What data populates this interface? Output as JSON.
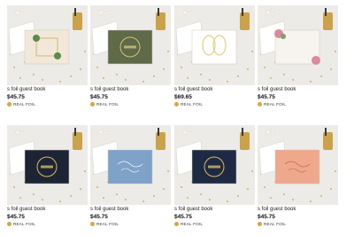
{
  "products": [
    {
      "title": "s foil guest book",
      "price": "$45.75",
      "badge": "REAL FOIL",
      "card_color": "#f1e8da",
      "accent": "#5c8a4a",
      "design": "greenery-frame"
    },
    {
      "title": "s foil guest book",
      "price": "$45.75",
      "badge": "REAL FOIL",
      "card_color": "#5e6a48",
      "accent": "#d8c07a",
      "design": "gold-wreath"
    },
    {
      "title": "s foil guest book",
      "price": "$69.65",
      "badge": "REAL FOIL",
      "card_color": "#ffffff",
      "accent": "#e2cf82",
      "design": "gold-angel-wings"
    },
    {
      "title": "s foil guest book",
      "price": "$45.75",
      "badge": "REAL FOIL",
      "card_color": "#f7f3ee",
      "accent": "#d88aa0",
      "design": "floral-corners"
    },
    {
      "title": "s foil guest book",
      "price": "$45.75",
      "badge": "REAL FOIL",
      "card_color": "#1d2436",
      "accent": "#d8b860",
      "design": "navy-gold-wreath"
    },
    {
      "title": "s foil guest book",
      "price": "$45.75",
      "badge": "REAL FOIL",
      "card_color": "#7ea2c8",
      "accent": "#ffffff",
      "design": "blue-script"
    },
    {
      "title": "s foil guest book",
      "price": "$45.75",
      "badge": "REAL FOIL",
      "card_color": "#1e2a44",
      "accent": "#d8b860",
      "design": "navy-circle-wreath"
    },
    {
      "title": "s foil guest book",
      "price": "$45.75",
      "badge": "REAL FOIL",
      "card_color": "#efa88c",
      "accent": "#b86c55",
      "design": "peach-script"
    }
  ]
}
